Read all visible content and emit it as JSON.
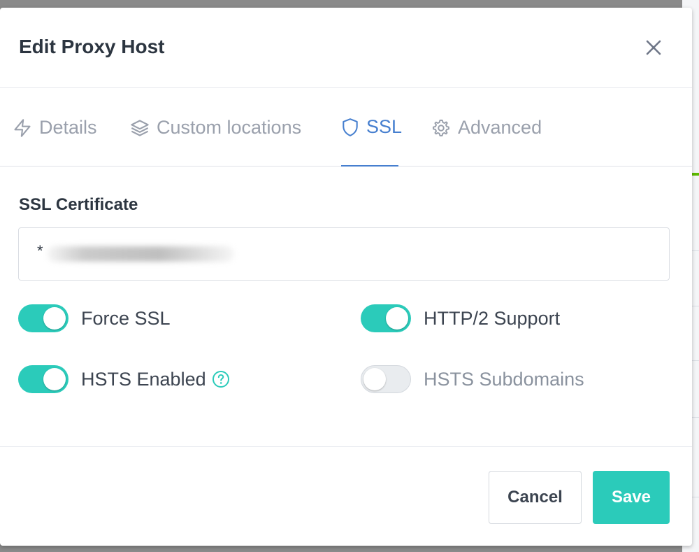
{
  "modal": {
    "title": "Edit Proxy Host"
  },
  "tabs": [
    {
      "label": "Details",
      "icon": "bolt-icon"
    },
    {
      "label": "Custom locations",
      "icon": "layers-icon"
    },
    {
      "label": "SSL",
      "icon": "shield-icon",
      "active": true
    },
    {
      "label": "Advanced",
      "icon": "gear-icon"
    }
  ],
  "ssl": {
    "certificate_label": "SSL Certificate",
    "certificate_value": "*"
  },
  "toggles": [
    {
      "label": "Force SSL",
      "on": true
    },
    {
      "label": "HTTP/2 Support",
      "on": true
    },
    {
      "label": "HSTS Enabled",
      "on": true,
      "help": true
    },
    {
      "label": "HSTS Subdomains",
      "on": false
    }
  ],
  "footer": {
    "cancel_label": "Cancel",
    "save_label": "Save"
  },
  "colors": {
    "accent_teal": "#2bcbba",
    "active_tab_blue": "#467fcf",
    "muted_text": "#9aa0ac"
  }
}
